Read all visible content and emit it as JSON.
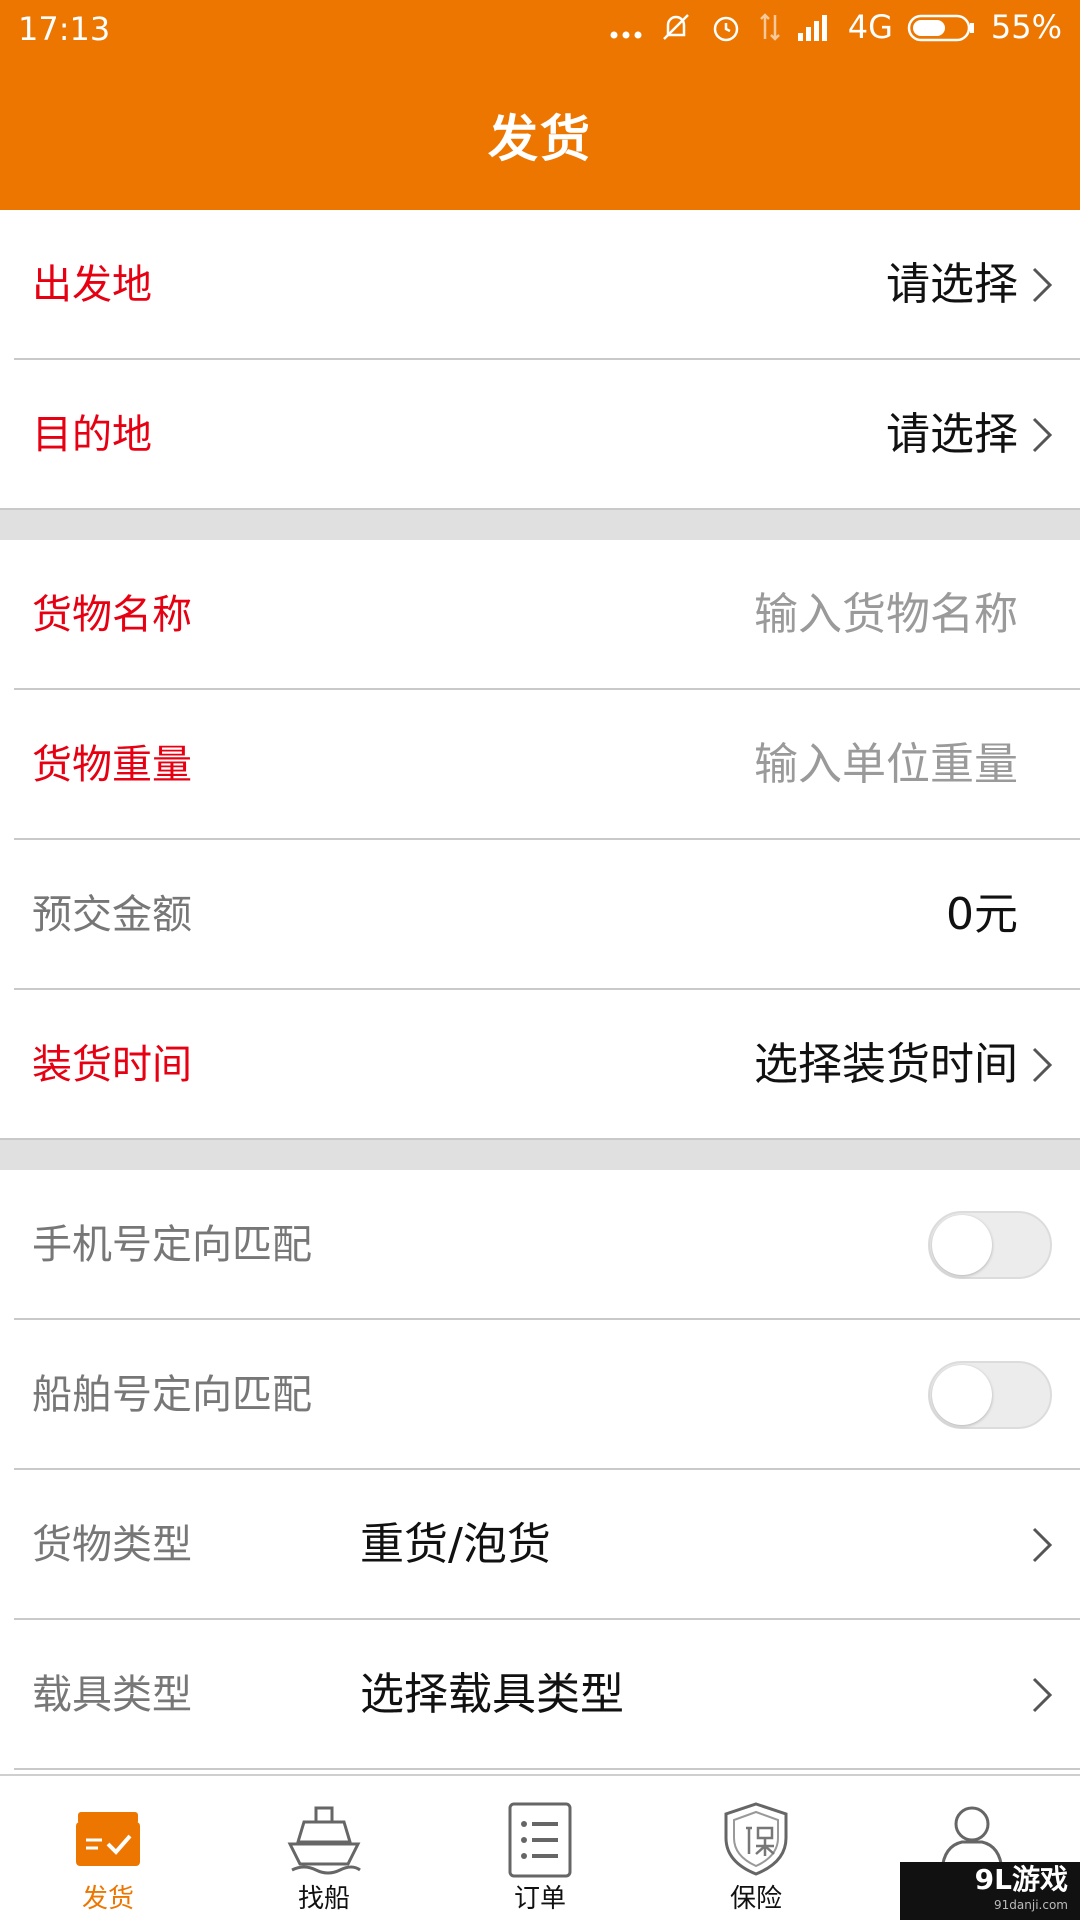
{
  "status_bar": {
    "time": "17:13",
    "network": "4G",
    "battery": "55%"
  },
  "app_bar": {
    "title": "发货"
  },
  "form": {
    "origin": {
      "label": "出发地",
      "value": "请选择"
    },
    "destination": {
      "label": "目的地",
      "value": "请选择"
    },
    "cargo_name": {
      "label": "货物名称",
      "placeholder": "输入货物名称"
    },
    "cargo_weight": {
      "label": "货物重量",
      "placeholder": "输入单位重量"
    },
    "prepay": {
      "label": "预交金额",
      "value": "0元"
    },
    "loading_time": {
      "label": "装货时间",
      "value": "选择装货时间"
    },
    "phone_match": {
      "label": "手机号定向匹配",
      "enabled": false
    },
    "ship_match": {
      "label": "船舶号定向匹配",
      "enabled": false
    },
    "cargo_type": {
      "label": "货物类型",
      "value": "重货/泡货"
    },
    "vehicle_type": {
      "label": "载具类型",
      "value": "选择载具类型"
    }
  },
  "tabs": [
    {
      "label": "发货",
      "icon": "ship-goods-icon",
      "active": true
    },
    {
      "label": "找船",
      "icon": "ship-icon",
      "active": false
    },
    {
      "label": "订单",
      "icon": "order-list-icon",
      "active": false
    },
    {
      "label": "保险",
      "icon": "insurance-shield-icon",
      "active": false
    },
    {
      "label": "",
      "icon": "user-profile-icon",
      "active": false
    }
  ],
  "watermark": {
    "main": "9L游戏",
    "sub": "91danji.com"
  },
  "colors": {
    "primary": "#EC7600",
    "required": "#E60012",
    "placeholder": "#9a9a9a"
  }
}
